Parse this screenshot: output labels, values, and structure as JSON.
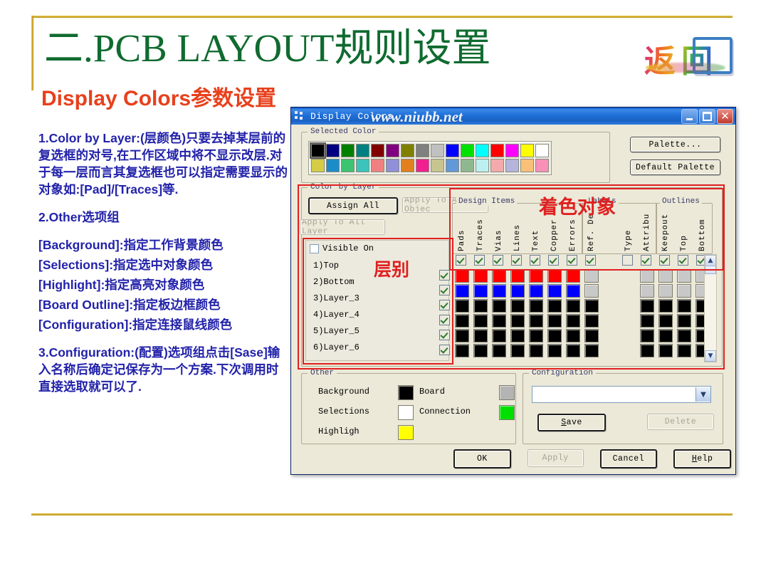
{
  "slide": {
    "title_num": "二.",
    "title_en": "PCB LAYOUT",
    "title_cn": "规则设置",
    "subtitle": "Display Colors参数设置",
    "back_badge": "返回",
    "body_paragraphs": [
      "1.Color by Layer:(层颜色)只要去掉某层前的复选框的对号,在工作区域中将不显示改层.对于每一层而言其复选框也可以指定需要显示的对象如:[Pad]/[Traces]等.",
      "2.Other选项组",
      "[Background]:指定工作背景颜色",
      "[Selections]:指定选中对象颜色",
      "[Highlight]:指定高亮对象颜色",
      "[Board Outline]:指定板边框颜色",
      "[Configuration]:指定连接鼠线颜色",
      "3.Configuration:(配置)选项组点击[Sase]输入名称后确定记保存为一个方案.下次调用时直接选取就可以了."
    ],
    "annotations": {
      "color_objects": "着色对象",
      "layers": "层别"
    }
  },
  "dialog": {
    "title": "Display Colors",
    "watermark": "www.niubb.net",
    "window_buttons": {
      "minimize": "–",
      "maximize": "□",
      "close": "✕"
    },
    "selected_color": {
      "legend": "Selected Color",
      "row1": [
        "#000000",
        "#000080",
        "#008000",
        "#008080",
        "#800000",
        "#800080",
        "#808000",
        "#808080",
        "#c0c0c0",
        "#0000ff",
        "#00e000",
        "#00ffff",
        "#ff0000",
        "#ff00ff",
        "#ffff00",
        "#ffffff"
      ],
      "row2": [
        "#d4cc46",
        "#1c8cc8",
        "#3cc470",
        "#3cc4bc",
        "#f08080",
        "#9090d8",
        "#e08020",
        "#f02090",
        "#c8c490",
        "#6098d8",
        "#90b890",
        "#bcf0f0",
        "#f4aaaa",
        "#b4b4dc",
        "#f8c078",
        "#f890b8"
      ],
      "selected_index": 0
    },
    "palette_button": "Palette...",
    "default_palette_button": "Default Palette",
    "color_by_layer": {
      "legend": "Color by Layer",
      "assign_all": "Assign All",
      "apply_to_all_objects": "Apply To All Objec",
      "apply_to_all_layers": "Apply To All Layer",
      "visible_only": "Visible On",
      "visible_only_checked": false,
      "layers": [
        {
          "label": "1)Top",
          "checked": true
        },
        {
          "label": "2)Bottom",
          "checked": true
        },
        {
          "label": "3)Layer_3",
          "checked": true
        },
        {
          "label": "4)Layer_4",
          "checked": true
        },
        {
          "label": "5)Layer_5",
          "checked": true
        },
        {
          "label": "6)Layer_6",
          "checked": true
        }
      ],
      "group_headers": [
        {
          "label": "Design Items",
          "span": 7
        },
        {
          "label": "Labels",
          "span": 3
        },
        {
          "label": "Outlines",
          "span": 3
        }
      ],
      "columns": [
        {
          "label": "Pads",
          "checked": true
        },
        {
          "label": "Traces",
          "checked": true
        },
        {
          "label": "Vias",
          "checked": true
        },
        {
          "label": "Lines",
          "checked": true
        },
        {
          "label": "Text",
          "checked": true
        },
        {
          "label": "Copper",
          "checked": true
        },
        {
          "label": "Errors",
          "checked": true
        },
        {
          "label": "Ref. De",
          "checked": true
        },
        {
          "label": "Type",
          "checked": false
        },
        {
          "label": "Attribu",
          "checked": true
        },
        {
          "label": "Keepout",
          "checked": true
        },
        {
          "label": "Top",
          "checked": true
        },
        {
          "label": "Bottom",
          "checked": true
        }
      ],
      "grid": [
        [
          "#ff0000",
          "#ff0000",
          "#ff0000",
          "#ff0000",
          "#ff0000",
          "#ff0000",
          "#ff0000",
          "#c8c8c8",
          null,
          "#c8c8c8",
          "#c8c8c8",
          "#c8c8c8",
          "#c8c8c8"
        ],
        [
          "#0000ff",
          "#0000ff",
          "#0000ff",
          "#0000ff",
          "#0000ff",
          "#0000ff",
          "#0000ff",
          "#c8c8c8",
          null,
          "#c8c8c8",
          "#c8c8c8",
          "#c8c8c8",
          "#c8c8c8"
        ],
        [
          "#000000",
          "#000000",
          "#000000",
          "#000000",
          "#000000",
          "#000000",
          "#000000",
          "#000000",
          null,
          "#000000",
          "#000000",
          "#000000",
          "#000000"
        ],
        [
          "#000000",
          "#000000",
          "#000000",
          "#000000",
          "#000000",
          "#000000",
          "#000000",
          "#000000",
          null,
          "#000000",
          "#000000",
          "#000000",
          "#000000"
        ],
        [
          "#000000",
          "#000000",
          "#000000",
          "#000000",
          "#000000",
          "#000000",
          "#000000",
          "#000000",
          null,
          "#000000",
          "#000000",
          "#000000",
          "#000000"
        ],
        [
          "#000000",
          "#000000",
          "#000000",
          "#000000",
          "#000000",
          "#000000",
          "#000000",
          "#000000",
          null,
          "#000000",
          "#000000",
          "#000000",
          "#000000"
        ]
      ]
    },
    "other": {
      "legend": "Other",
      "items": [
        {
          "label": "Background",
          "color": "#000000"
        },
        {
          "label": "Selections",
          "color": "#ffffff"
        },
        {
          "label": "Highligh",
          "color": "#ffff00"
        },
        {
          "label": "Board",
          "color": "#b4b4b4"
        },
        {
          "label": "Connection",
          "color": "#00e000"
        }
      ]
    },
    "configuration": {
      "legend": "Configuration",
      "combo_value": "",
      "save_button": "Save",
      "delete_button": "Delete"
    },
    "footer_buttons": [
      {
        "label": "OK",
        "disabled": false
      },
      {
        "label": "Apply",
        "disabled": true
      },
      {
        "label": "Cancel",
        "disabled": false
      },
      {
        "label": "Help",
        "disabled": false
      }
    ]
  }
}
